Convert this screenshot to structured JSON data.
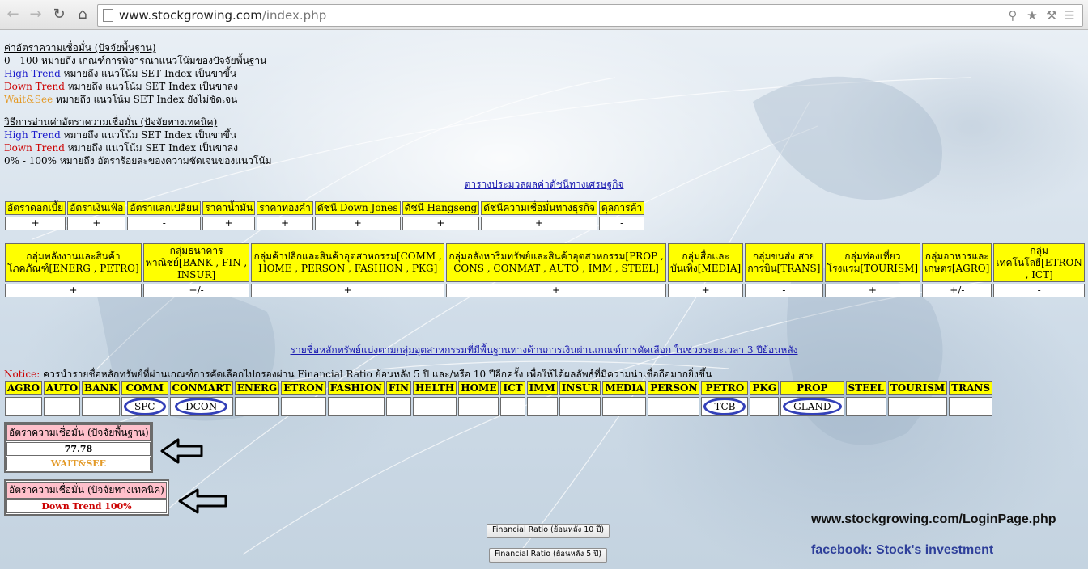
{
  "browser": {
    "url_domain": "www.stockgrowing.com",
    "url_path": "/index.php"
  },
  "legend_fundamental": {
    "title": "ค่าอัตราความเชื่อมั่น (ปัจจัยพื้นฐาน)",
    "line1": "0 - 100 หมายถึง เกณฑ์การพิจารณาแนวโน้มของปัจจัยพื้นฐาน",
    "high_label": "High Trend",
    "high_text": " หมายถึง แนวโน้ม SET Index เป็นขาขึ้น",
    "down_label": "Down Trend",
    "down_text": " หมายถึง แนวโน้ม SET Index เป็นขาลง",
    "wait_label": "Wait&See",
    "wait_text": " หมายถึง แนวโน้ม SET Index ยังไม่ชัดเจน"
  },
  "legend_technical": {
    "title": "วิธีการอ่านค่าอัตราความเชื่อมั่น (ปัจจัยทางเทคนิค)",
    "high_label": "High Trend",
    "high_text": " หมายถึง แนวโน้ม SET Index เป็นขาขึ้น",
    "down_label": "Down Trend",
    "down_text": " หมายถึง แนวโน้ม SET Index เป็นขาลง",
    "pct_text": "0% - 100% หมายถึง อัตราร้อยละของความชัดเจนของแนวโน้ม"
  },
  "econ_link": "ตารางประมวลผลค่าดัชนีทางเศรษฐกิจ",
  "econ_table": {
    "headers": [
      "อัตราดอกเบี้ย",
      "อัตราเงินเฟ้อ",
      "อัตราแลกเปลี่ยน",
      "ราคาน้ำมัน",
      "ราคาทองคำ",
      "ดัชนี Down Jones",
      "ดัชนี Hangseng",
      "ดัชนีความเชื่อมั่นทางธุรกิจ",
      "ดุลการค้า"
    ],
    "values": [
      "+",
      "+",
      "-",
      "+",
      "+",
      "+",
      "+",
      "+",
      "-"
    ]
  },
  "sector_table": {
    "headers": [
      [
        "กลุ่มพลังงานและสินค้า",
        "โภคภัณฑ์[ENERG , PETRO]"
      ],
      [
        "กลุ่มธนาคาร",
        "พาณิชย์[BANK , FIN ,",
        "INSUR]"
      ],
      [
        "กลุ่มค้าปลีกและสินค้าอุตสาหกรรม[COMM ,",
        "HOME , PERSON , FASHION , PKG]"
      ],
      [
        "กลุ่มอสังหาริมทรัพย์และสินค้าอุตสาหกรรม[PROP ,",
        "CONS , CONMAT , AUTO , IMM , STEEL]"
      ],
      [
        "กลุ่มสื่อและ",
        "บันเทิง[MEDIA]"
      ],
      [
        "กลุ่มขนส่ง สาย",
        "การบิน[TRANS]"
      ],
      [
        "กลุ่มท่องเที่ยว",
        "โรงแรม[TOURISM]"
      ],
      [
        "กลุ่มอาหารและ",
        "เกษตร[AGRO]"
      ],
      [
        "กลุ่ม",
        "เทคโนโลยี[ETRON",
        ", ICT]"
      ]
    ],
    "values": [
      "+",
      "+/-",
      "+",
      "+",
      "+",
      "-",
      "+",
      "+/-",
      "-"
    ]
  },
  "stock_link": "รายชื่อหลักทรัพย์แบ่งตามกลุ่มอุตสาหกรรมที่มีพื้นฐานทางด้านการเงินผ่านเกณฑ์การคัดเลือก ในช่วงระยะเวลา 3 ปีย้อนหลัง",
  "notice": {
    "label": "Notice:",
    "text": " ควรนำรายชื่อหลักทรัพย์ที่ผ่านเกณฑ์การคัดเลือกไปกรองผ่าน Financial Ratio ย้อนหลัง 5 ปี และ/หรือ 10 ปีอีกครั้ง เพื่อให้ได้ผลลัพธ์ที่มีความน่าเชื่อถือมากยิ่งขึ้น"
  },
  "industry_table": {
    "headers": [
      "AGRO",
      "AUTO",
      "BANK",
      "COMM",
      "CONMART",
      "ENERG",
      "ETRON",
      "FASHION",
      "FIN",
      "HELTH",
      "HOME",
      "ICT",
      "IMM",
      "INSUR",
      "MEDIA",
      "PERSON",
      "PETRO",
      "PKG",
      "PROP",
      "STEEL",
      "TOURISM",
      "TRANS"
    ],
    "values": [
      "",
      "",
      "",
      "SPC",
      "DCON",
      "",
      "",
      "",
      "",
      "",
      "",
      "",
      "",
      "",
      "",
      "",
      "TCB",
      "",
      "GLAND",
      "",
      "",
      ""
    ]
  },
  "fundamental_box": {
    "title": "อัตราความเชื่อมั่น (ปัจจัยพื้นฐาน)",
    "value": "77.78",
    "status": "WAIT&SEE"
  },
  "technical_box": {
    "title": "อัตราความเชื่อมั่น (ปัจจัยทางเทคนิค)",
    "status": "Down Trend 100%"
  },
  "buttons": {
    "fr10": "Financial Ratio (ย้อนหลัง 10 ปี)",
    "fr5": "Financial Ratio (ย้อนหลัง 5 ปี)"
  },
  "promo": {
    "login_url": "www.stockgrowing.com/LoginPage.php",
    "facebook": "facebook:  Stock's investment"
  },
  "colors": {
    "header_yellow": "#ffff00",
    "box_pink": "#ffc0cb",
    "circle_blue": "#3340b8",
    "high_blue": "#1a1acc",
    "down_red": "#cc0000",
    "wait_orange": "#e39a28"
  }
}
